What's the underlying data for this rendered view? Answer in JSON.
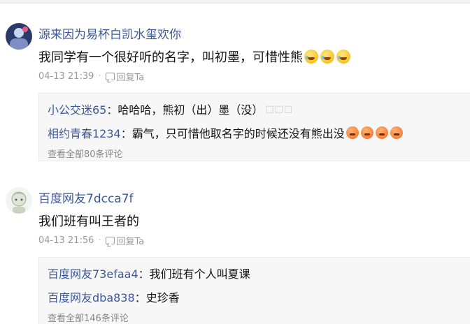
{
  "comments": [
    {
      "username": "源来因为易杯白凯水玺欢你",
      "content": "我同学有一个很好听的名字，叫初墨，可惜性熊",
      "emojis": [
        "laugh-cry-emoji",
        "laugh-cry-emoji",
        "laugh-cry-emoji"
      ],
      "time": "04-13 21:39",
      "reply_label": "回复Ta",
      "replies": [
        {
          "user": "小公交迷65",
          "text": "哈哈哈，熊初（出）墨（没）",
          "trailing": "□□□"
        },
        {
          "user": "相约青春1234",
          "text": "霸气，只可惜他取名字的时候还没有熊出没",
          "emojis": [
            "angry-emoji",
            "angry-emoji",
            "angry-emoji",
            "angry-emoji"
          ]
        }
      ],
      "view_all": "查看全部80条评论"
    },
    {
      "username": "百度网友7dcca7f",
      "content": "我们班有叫王者的",
      "time": "04-13 21:56",
      "reply_label": "回复Ta",
      "replies": [
        {
          "user": "百度网友73efaa4",
          "text": "我们班有个人叫夏课"
        },
        {
          "user": "百度网友dba838",
          "text": "史珍香"
        }
      ],
      "view_all": "查看全部146条评论"
    }
  ],
  "colors": {
    "username": "#3b5998",
    "meta": "#999999",
    "reply_bg": "#f7f7f7"
  }
}
